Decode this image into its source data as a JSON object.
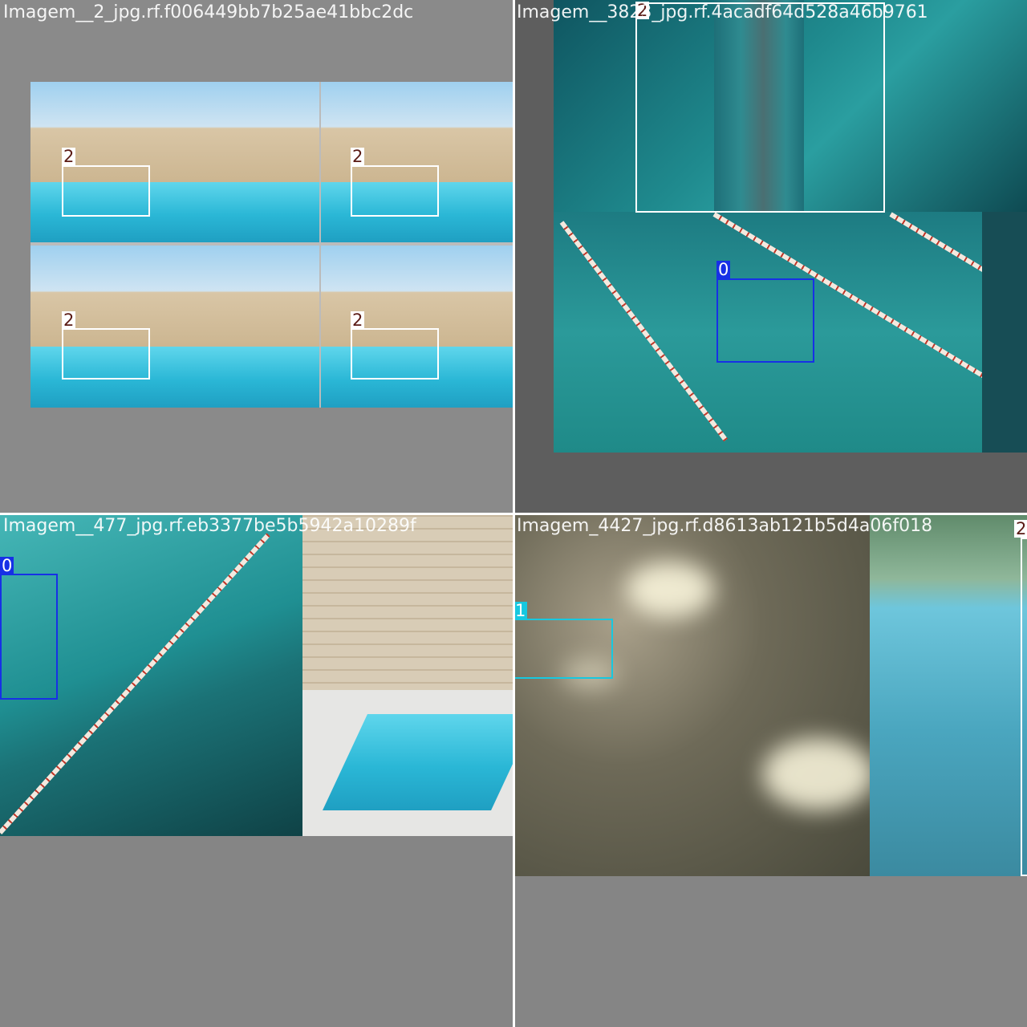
{
  "tiles": [
    {
      "caption": "Imagem__2_jpg.rf.f006449bb7b25ae41bbc2dc",
      "labels": [
        "2",
        "2",
        "2",
        "2"
      ]
    },
    {
      "caption": "Imagem__3823_jpg.rf.4acadf64d528a46b9761",
      "labels": [
        "2",
        "0"
      ]
    },
    {
      "caption": "Imagem__477_jpg.rf.eb3377be5b5942a10289f",
      "labels": [
        "0"
      ]
    },
    {
      "caption": "Imagem_4427_jpg.rf.d8613ab121b5d4a06f018",
      "labels": [
        "1",
        "2"
      ]
    }
  ],
  "classes": {
    "0": {
      "name": "0",
      "color": "#1730e6"
    },
    "1": {
      "name": "1",
      "color": "#17c8e0"
    },
    "2": {
      "name": "2",
      "color": "#ffffff"
    }
  }
}
